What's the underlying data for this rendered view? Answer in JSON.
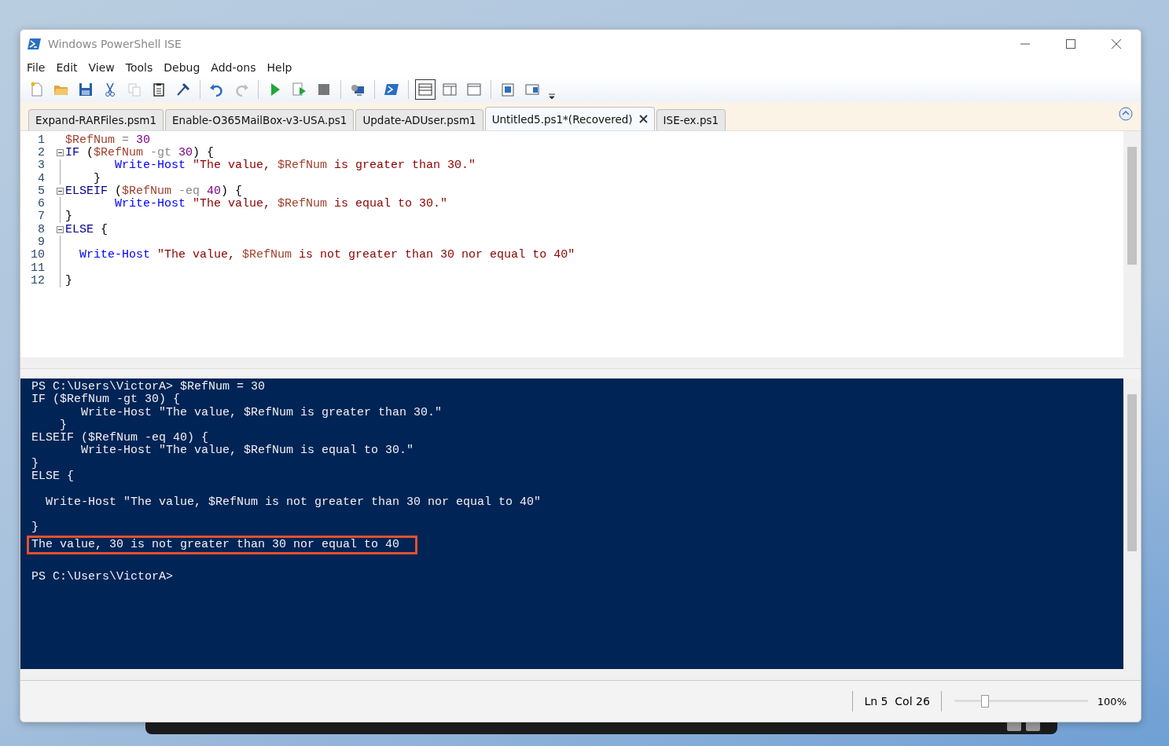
{
  "window": {
    "title": "Windows PowerShell ISE"
  },
  "menu": [
    "File",
    "Edit",
    "View",
    "Tools",
    "Debug",
    "Add-ons",
    "Help"
  ],
  "tabs": [
    {
      "label": "Expand-RARFiles.psm1",
      "selected": false,
      "closable": false
    },
    {
      "label": "Enable-O365MailBox-v3-USA.ps1",
      "selected": false,
      "closable": false
    },
    {
      "label": "Update-ADUser.psm1",
      "selected": false,
      "closable": false
    },
    {
      "label": "Untitled5.ps1*(Recovered)",
      "selected": true,
      "closable": true
    },
    {
      "label": "ISE-ex.ps1",
      "selected": false,
      "closable": false
    }
  ],
  "editor": {
    "lines": [
      {
        "number": "1",
        "fold": false,
        "in_block": false,
        "tokens": [
          {
            "kind": "variable",
            "text": "$RefNum"
          },
          {
            "kind": "operator",
            "text": " = "
          },
          {
            "kind": "number",
            "text": "30"
          }
        ]
      },
      {
        "number": "2",
        "fold": true,
        "in_block": false,
        "tokens": [
          {
            "kind": "keyword",
            "text": "IF"
          },
          {
            "kind": "plain",
            "text": " ("
          },
          {
            "kind": "variable",
            "text": "$RefNum"
          },
          {
            "kind": "operator",
            "text": " -gt "
          },
          {
            "kind": "number",
            "text": "30"
          },
          {
            "kind": "plain",
            "text": ") {"
          }
        ]
      },
      {
        "number": "3",
        "fold": false,
        "in_block": true,
        "tokens": [
          {
            "kind": "command",
            "text": "       Write-Host"
          },
          {
            "kind": "string",
            "text": " \"The value, "
          },
          {
            "kind": "variable",
            "text": "$RefNum"
          },
          {
            "kind": "string",
            "text": " is greater than 30.\""
          }
        ]
      },
      {
        "number": "4",
        "fold": false,
        "in_block": true,
        "tokens": [
          {
            "kind": "plain",
            "text": "    }"
          }
        ]
      },
      {
        "number": "5",
        "fold": true,
        "in_block": false,
        "tokens": [
          {
            "kind": "keyword",
            "text": "ELSEIF"
          },
          {
            "kind": "plain",
            "text": " ("
          },
          {
            "kind": "variable",
            "text": "$RefNum"
          },
          {
            "kind": "operator",
            "text": " -eq "
          },
          {
            "kind": "number",
            "text": "40"
          },
          {
            "kind": "plain",
            "text": ") {"
          }
        ]
      },
      {
        "number": "6",
        "fold": false,
        "in_block": true,
        "tokens": [
          {
            "kind": "command",
            "text": "       Write-Host"
          },
          {
            "kind": "string",
            "text": " \"The value, "
          },
          {
            "kind": "variable",
            "text": "$RefNum"
          },
          {
            "kind": "string",
            "text": " is equal to 30.\""
          }
        ]
      },
      {
        "number": "7",
        "fold": false,
        "in_block": true,
        "tokens": [
          {
            "kind": "plain",
            "text": "}"
          }
        ]
      },
      {
        "number": "8",
        "fold": true,
        "in_block": false,
        "tokens": [
          {
            "kind": "keyword",
            "text": "ELSE"
          },
          {
            "kind": "plain",
            "text": " {"
          }
        ]
      },
      {
        "number": "9",
        "fold": false,
        "in_block": true
      },
      {
        "number": "10",
        "fold": false,
        "in_block": true,
        "tokens": [
          {
            "kind": "command",
            "text": "  Write-Host"
          },
          {
            "kind": "string",
            "text": " \"The value, "
          },
          {
            "kind": "variable",
            "text": "$RefNum"
          },
          {
            "kind": "string",
            "text": " is not greater than 30 nor equal to 40\""
          }
        ]
      },
      {
        "number": "11",
        "fold": false,
        "in_block": true
      },
      {
        "number": "12",
        "fold": false,
        "in_block": true,
        "tokens": [
          {
            "kind": "plain",
            "text": "}"
          }
        ]
      }
    ]
  },
  "console": {
    "lines": [
      {
        "text": "PS C:\\Users\\VictorA> $RefNum = 30",
        "highlighted": false
      },
      {
        "text": "IF ($RefNum -gt 30) {",
        "highlighted": false
      },
      {
        "text": "       Write-Host \"The value, $RefNum is greater than 30.\"",
        "highlighted": false
      },
      {
        "text": "    }",
        "highlighted": false
      },
      {
        "text": "ELSEIF ($RefNum -eq 40) {",
        "highlighted": false
      },
      {
        "text": "       Write-Host \"The value, $RefNum is equal to 30.\"",
        "highlighted": false
      },
      {
        "text": "}",
        "highlighted": false
      },
      {
        "text": "ELSE {",
        "highlighted": false
      },
      {
        "highlighted": false
      },
      {
        "text": "  Write-Host \"The value, $RefNum is not greater than 30 nor equal to 40\"",
        "highlighted": false
      },
      {
        "highlighted": false
      },
      {
        "text": "}",
        "highlighted": false
      },
      {
        "text": "The value, 30 is not greater than 30 nor equal to 40",
        "highlighted": true
      },
      {
        "highlighted": false
      },
      {
        "text": "PS C:\\Users\\VictorA>",
        "highlighted": false
      }
    ]
  },
  "status_bar": {
    "position": "Ln 5  Col 26",
    "zoom": {
      "level": 0.2
    },
    "zoom_label": "100%"
  }
}
